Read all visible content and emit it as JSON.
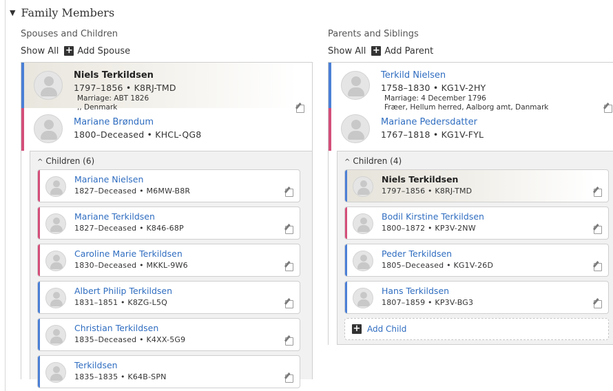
{
  "section": {
    "title": "Family Members"
  },
  "left": {
    "title": "Spouses and Children",
    "show_all": "Show All",
    "add_label": "Add Spouse",
    "husband": {
      "name": "Niels Terkildsen",
      "lifespan": "1797–1856",
      "id": "K8RJ-TMD"
    },
    "marriage": {
      "date": "Marriage: ABT 1826",
      "place": ",, Denmark"
    },
    "wife": {
      "name": "Mariane Brøndum",
      "lifespan": "1800–Deceased",
      "id": "KHCL-QG8"
    },
    "children_label": "Children (6)",
    "children": [
      {
        "name": "Mariane Nielsen",
        "lifespan": "1827–Deceased",
        "id": "M6MW-B8R",
        "gender": "female"
      },
      {
        "name": "Mariane Terkildsen",
        "lifespan": "1827–Deceased",
        "id": "K846-68P",
        "gender": "female"
      },
      {
        "name": "Caroline Marie Terkildsen",
        "lifespan": "1830–Deceased",
        "id": "MKKL-9W6",
        "gender": "female"
      },
      {
        "name": "Albert Philip Terkildsen",
        "lifespan": "1831–1851",
        "id": "K8ZG-L5Q",
        "gender": "male"
      },
      {
        "name": "Christian Terkildsen",
        "lifespan": "1835–Deceased",
        "id": "K4XX-5G9",
        "gender": "male"
      },
      {
        "name": "Terkildsen",
        "lifespan": "1835–1835",
        "id": "K64B-SPN",
        "gender": "male"
      }
    ]
  },
  "right": {
    "title": "Parents and Siblings",
    "show_all": "Show All",
    "add_label": "Add Parent",
    "father": {
      "name": "Terkild Nielsen",
      "lifespan": "1758–1830",
      "id": "KG1V-2HY"
    },
    "marriage": {
      "date": "Marriage: 4 December 1796",
      "place": "Fræer, Hellum herred, Aalborg amt, Danmark"
    },
    "mother": {
      "name": "Mariane Pedersdatter",
      "lifespan": "1767–1818",
      "id": "KG1V-FYL"
    },
    "children_label": "Children (4)",
    "children": [
      {
        "name": "Niels Terkildsen",
        "lifespan": "1797–1856",
        "id": "K8RJ-TMD",
        "gender": "male"
      },
      {
        "name": "Bodil Kirstine Terkildsen",
        "lifespan": "1800–1872",
        "id": "KP3V-2NW",
        "gender": "female"
      },
      {
        "name": "Peder Terkildsen",
        "lifespan": "1805–Deceased",
        "id": "KG1V-26D",
        "gender": "male"
      },
      {
        "name": "Hans Terkildsen",
        "lifespan": "1807–1859",
        "id": "KP3V-BG3",
        "gender": "male"
      }
    ],
    "add_child": "Add Child"
  },
  "separator": "•",
  "colors": {
    "male": "#4a7fd6",
    "female": "#d44e7a",
    "link": "#2f6dc0"
  },
  "icons": {
    "edit": "edit-icon",
    "collapse": "caret-down-icon",
    "add": "plus-icon",
    "avatar": "person-silhouette"
  }
}
